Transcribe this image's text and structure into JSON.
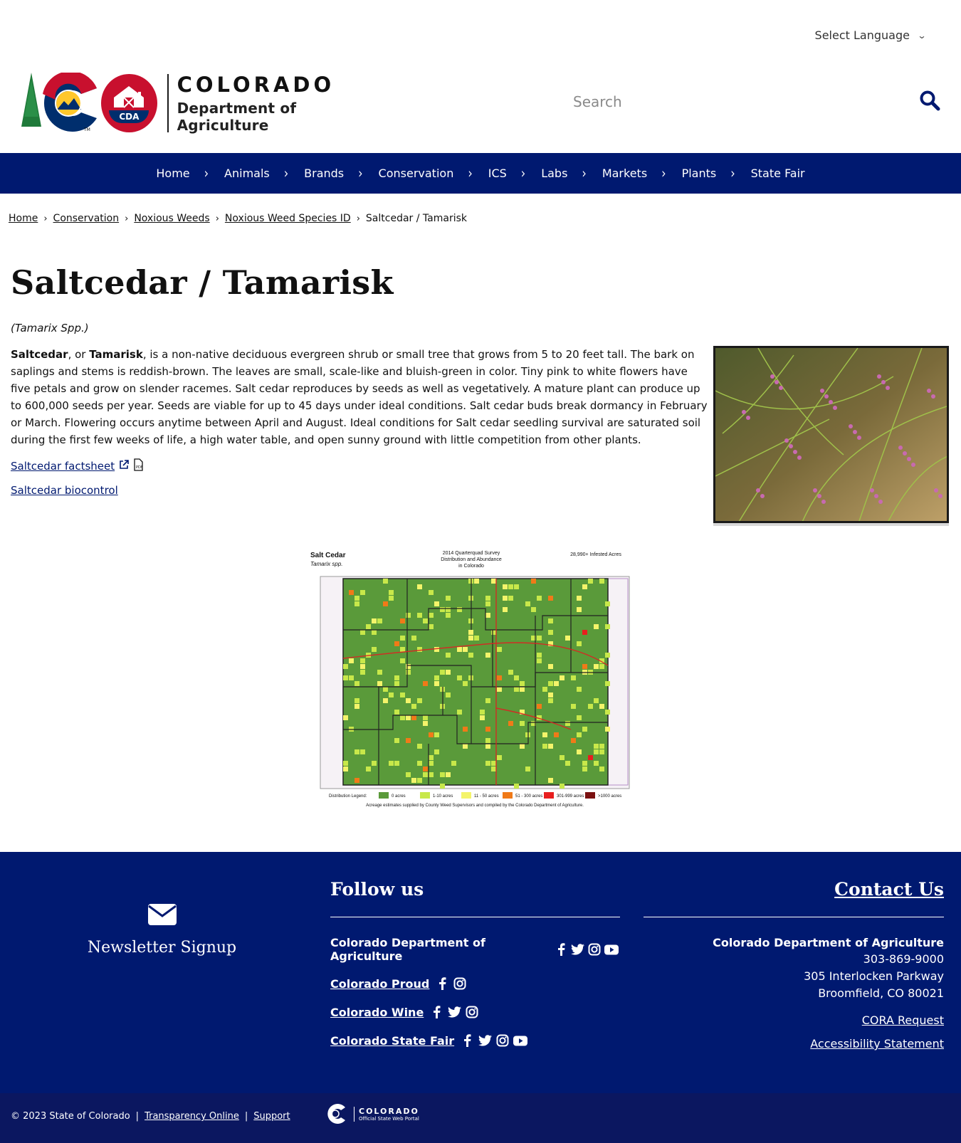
{
  "header": {
    "language_label": "Select Language",
    "logo": {
      "state_word": "COLORADO",
      "department": "Department of Agriculture",
      "seal_text": "CDA",
      "tm": "TM"
    },
    "search_placeholder": "Search"
  },
  "nav": {
    "items": [
      "Home",
      "Animals",
      "Brands",
      "Conservation",
      "ICS",
      "Labs",
      "Markets",
      "Plants",
      "State Fair"
    ]
  },
  "breadcrumb": {
    "links": [
      "Home",
      "Conservation",
      "Noxious Weeds",
      "Noxious Weed Species ID"
    ],
    "current": "Saltcedar / Tamarisk"
  },
  "content": {
    "title": "Saltcedar / Tamarisk",
    "scientific_name": "(Tamarix Spp.)",
    "desc_bold_1": "Saltcedar",
    "desc_mid": ", or ",
    "desc_bold_2": "Tamarisk",
    "desc_rest": ", is a non-native deciduous evergreen shrub or small tree that grows from 5 to 20 feet tall. The bark on saplings and stems is reddish-brown. The leaves are small, scale-like and bluish-green in color. Tiny pink to white flowers have five petals and grow on slender racemes. Salt cedar reproduces by seeds as well as vegetatively. A mature plant can produce up to 600,000 seeds per year. Seeds are viable for up to 45 days under ideal conditions. Salt cedar buds break dormancy in February or March. Flowering occurs anytime between April and August. Ideal conditions for Salt cedar seedling survival are saturated soil during the first few weeks of life, a high water table, and open sunny ground with little competition from other plants.",
    "factsheet_link": "Saltcedar factsheet",
    "biocontrol_link": "Saltcedar biocontrol"
  },
  "map": {
    "title": "Salt Cedar",
    "species": "Tamarix spp.",
    "survey_line1": "2014 Quarterquad Survey",
    "survey_line2": "Distribution and Abundance",
    "survey_line3": "in Colorado",
    "infested": "28,990+ Infested Acres",
    "legend_title": "Distribution Legend:",
    "legend": [
      {
        "label": "0 acres",
        "color": "#5a9a3a"
      },
      {
        "label": "1-10 acres",
        "color": "#c8e84a"
      },
      {
        "label": "11 - 50 acres",
        "color": "#f4f46a"
      },
      {
        "label": "51 - 300 acres",
        "color": "#f07a18"
      },
      {
        "label": "301-999 acres",
        "color": "#e81e1e"
      },
      {
        "label": ">1000 acres",
        "color": "#7a1010"
      }
    ],
    "credit": "Acreage estimates supplied by County Weed Supervisors and compiled by the Colorado Department of Agriculture."
  },
  "footer": {
    "newsletter": "Newsletter Signup",
    "follow_title": "Follow us",
    "social": [
      {
        "name": "Colorado Department of Agriculture",
        "linked": false,
        "icons": [
          "facebook-icon",
          "twitter-icon",
          "instagram-icon",
          "youtube-icon"
        ]
      },
      {
        "name": "Colorado Proud",
        "linked": true,
        "icons": [
          "facebook-icon",
          "instagram-icon"
        ]
      },
      {
        "name": "Colorado Wine",
        "linked": true,
        "icons": [
          "facebook-icon",
          "twitter-icon",
          "instagram-icon"
        ]
      },
      {
        "name": "Colorado State Fair",
        "linked": true,
        "icons": [
          "facebook-icon",
          "twitter-icon",
          "instagram-icon",
          "youtube-icon"
        ]
      }
    ],
    "contact_title": "Contact Us",
    "contact_org": "Colorado Department of Agriculture",
    "phone": "303-869-9000",
    "address1": "305 Interlocken Parkway",
    "address2": "Broomfield, CO 80021",
    "cora": "CORA Request",
    "accessibility": "Accessibility Statement"
  },
  "bottom": {
    "copyright": "© 2023 State of Colorado",
    "transparency": "Transparency Online",
    "support": "Support",
    "portal_title": "COLORADO",
    "portal_sub": "Official State Web Portal"
  },
  "colors": {
    "navy": "#001970",
    "footer_bottom": "#0b1760",
    "co_red": "#c8102e",
    "co_blue": "#002e6d",
    "co_gold": "#ffc72c"
  }
}
